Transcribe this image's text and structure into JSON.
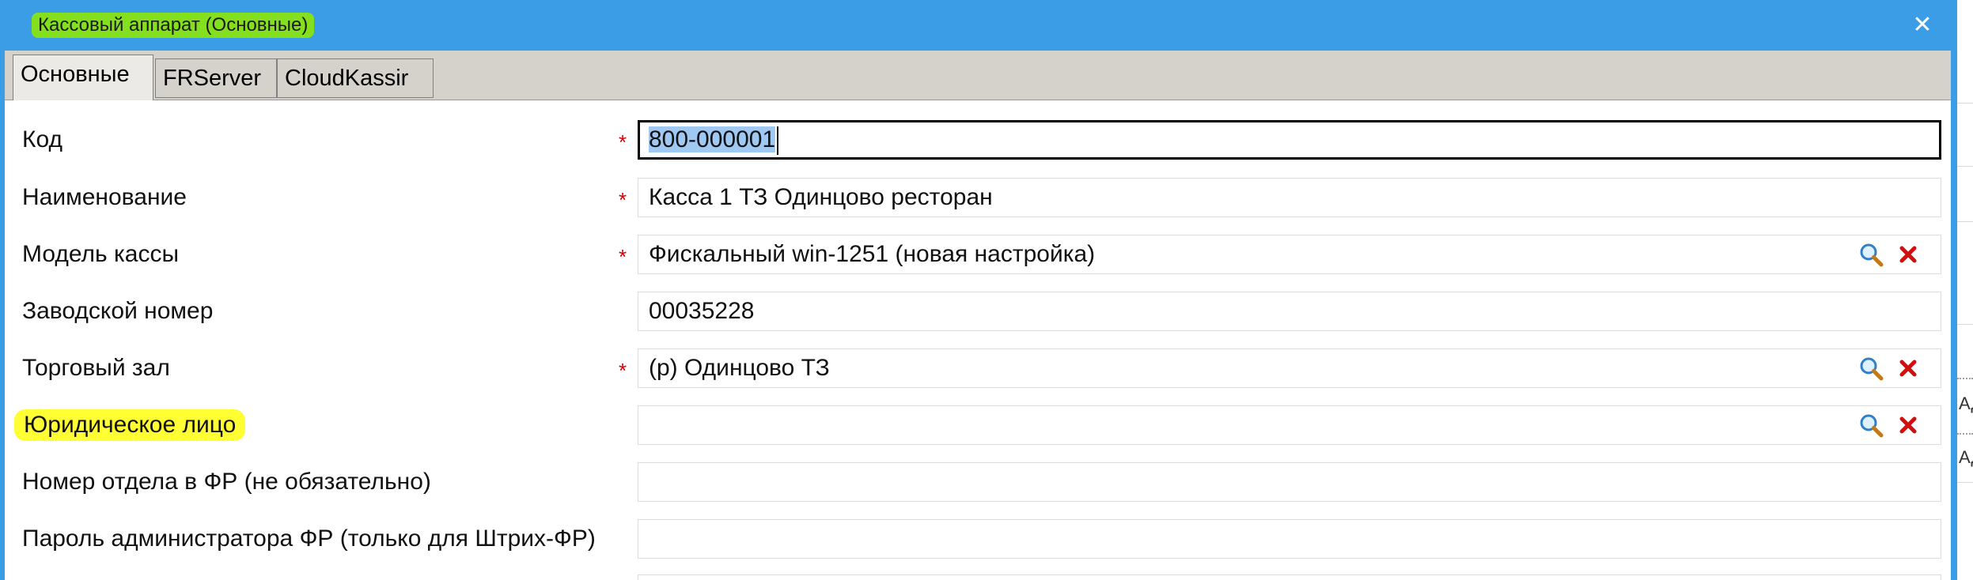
{
  "dialog": {
    "title": "Кассовый аппарат (Основные)",
    "close_label": "✕"
  },
  "tabs": [
    {
      "label": "Основные",
      "active": true
    },
    {
      "label": "FRServer",
      "active": false
    },
    {
      "label": "CloudKassir",
      "active": false
    }
  ],
  "form": {
    "required_mark": "*",
    "fields": [
      {
        "label": "Код",
        "value_selected": "800-000001",
        "required": true,
        "focused": true
      },
      {
        "label": "Наименование",
        "value": "Касса 1 ТЗ Одинцово ресторан",
        "required": true
      },
      {
        "label": "Модель кассы",
        "value": "Фискальный win-1251 (новая настройка)",
        "required": true,
        "lookup": true
      },
      {
        "label": "Заводской номер",
        "value": "00035228",
        "required": false
      },
      {
        "label": "Торговый зал",
        "value": "(р) Одинцово ТЗ",
        "required": true,
        "lookup": true
      },
      {
        "label": "Юридическое лицо",
        "value": "",
        "required": false,
        "lookup": true,
        "highlighted": true
      },
      {
        "label": "Номер отдела в ФР (не обязательно)",
        "value": "",
        "required": false
      },
      {
        "label": "Пароль администратора ФР (только для Штрих-ФР)",
        "value": "",
        "required": false
      }
    ]
  },
  "background": {
    "clipped_text_1": "АД",
    "clipped_text_2": "АД"
  },
  "colors": {
    "titlebar": "#3a9de6",
    "title_highlight": "#84e01f",
    "label_highlight": "#ffff33",
    "required": "#d40000",
    "selection": "#9fc9f3"
  }
}
